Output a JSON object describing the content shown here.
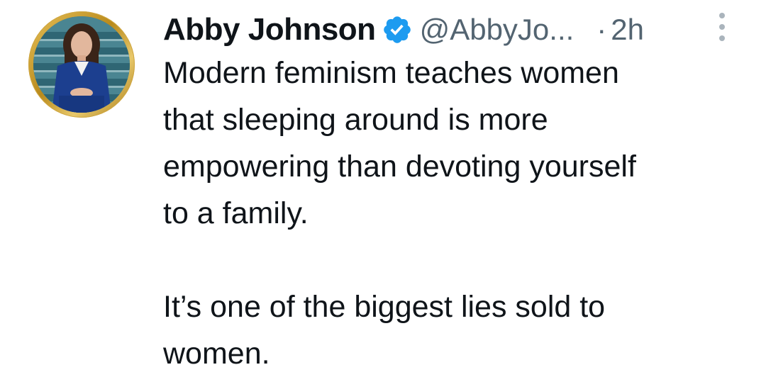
{
  "tweet": {
    "author": {
      "display_name": "Abby Johnson",
      "handle": "@AbbyJo...",
      "verified_badge": "verified-check-icon",
      "avatar": "profile-photo"
    },
    "separator": "·",
    "timestamp": "2h",
    "more_menu_icon": "more-vertical-icon",
    "text_lines": [
      "Modern feminism teaches women",
      "that sleeping around is more",
      "empowering than devoting yourself",
      "to a family."
    ],
    "text_lines_2": [
      "It’s one of the biggest lies sold to",
      "women."
    ]
  },
  "colors": {
    "text_primary": "#0f1419",
    "text_secondary": "#536471",
    "verified_blue": "#1d9bf0",
    "avatar_ring_gold": "#c9a035"
  }
}
